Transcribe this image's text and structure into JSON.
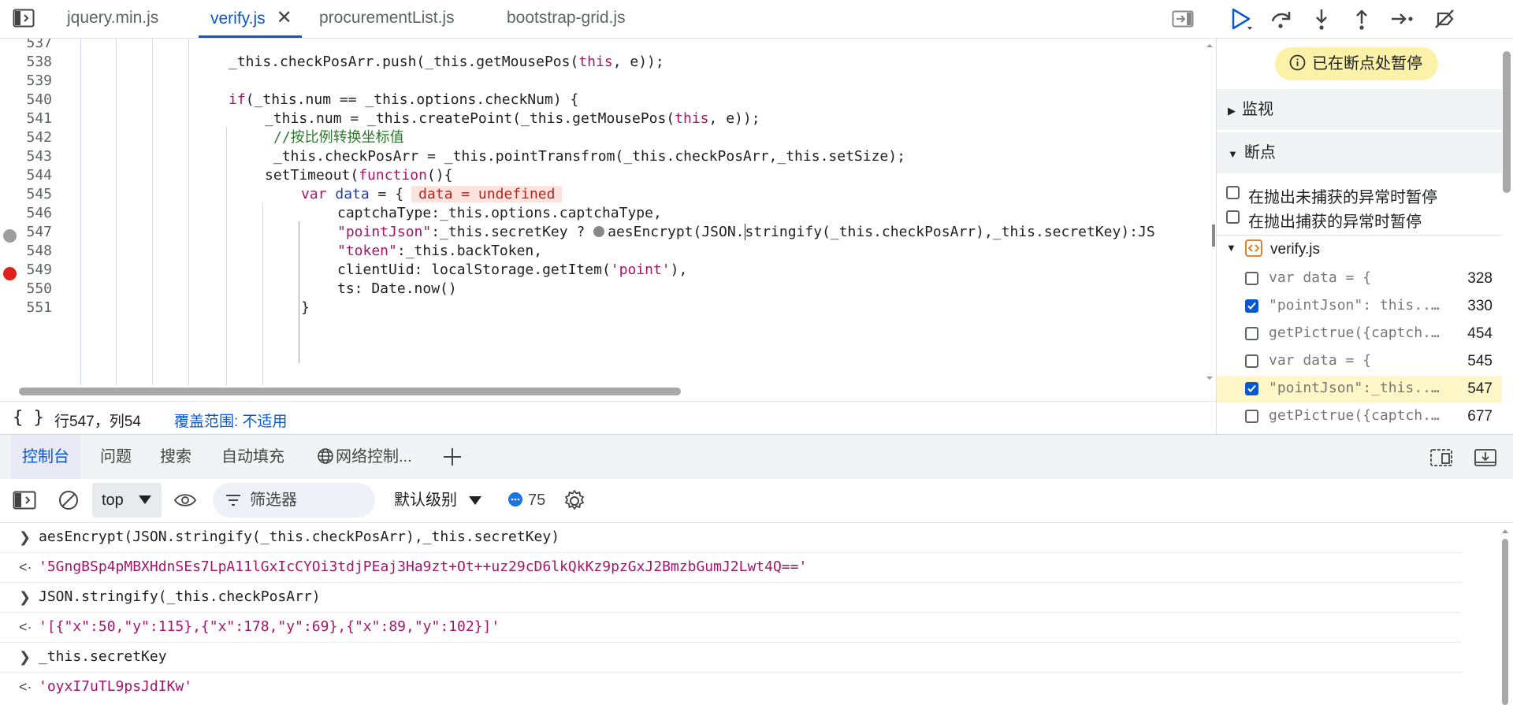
{
  "tabs": [
    {
      "label": "jquery.min.js",
      "active": false
    },
    {
      "label": "verify.js",
      "active": true
    },
    {
      "label": "procurementList.js",
      "active": false
    },
    {
      "label": "bootstrap-grid.js",
      "active": false
    }
  ],
  "code": {
    "lines": [
      {
        "n": "537"
      },
      {
        "n": "538"
      },
      {
        "n": "539"
      },
      {
        "n": "540"
      },
      {
        "n": "541"
      },
      {
        "n": "542"
      },
      {
        "n": "543"
      },
      {
        "n": "544"
      },
      {
        "n": "545"
      },
      {
        "n": "546"
      },
      {
        "n": "547"
      },
      {
        "n": "548"
      },
      {
        "n": "549"
      },
      {
        "n": "550"
      },
      {
        "n": "551"
      }
    ],
    "l538": "_this.checkPosArr.push(_this.getMousePos(",
    "l538_kw": "this",
    "l538_end": ", e));",
    "l540_kw": "if",
    "l540": "(_this.num == _this.options.checkNum) {",
    "l541": "_this.num = _this.createPoint(_this.getMousePos(",
    "l541_kw": "this",
    "l541_end": ", e));",
    "l542": "//按比例转换坐标值",
    "l543": "_this.checkPosArr = _this.pointTransfrom(_this.checkPosArr,_this.setSize);",
    "l544_a": "setTimeout(",
    "l544_kw": "function",
    "l544_b": "(){",
    "l545_kw": "var",
    "l545_var": "data",
    "l545_b": " = {",
    "l545_inline": "data = undefined",
    "l546": "captchaType:_this.options.captchaType,",
    "l547_str": "\"pointJson\"",
    "l547_a": ":_this.secretKey ? ",
    "l547_b": "aesEncrypt(JSON.",
    "l547_c": "stringify(_this.checkPosArr),_this.secretKey):JS",
    "l548_str": "\"token\"",
    "l548_a": ":_this.backToken,",
    "l549_a": "clientUid: localStorage.getItem(",
    "l549_str": "'point'",
    "l549_b": "),",
    "l550": "ts: Date.now()",
    "l551": "}"
  },
  "status": {
    "braces": "{ }",
    "position": "行547，列54",
    "coverage": "覆盖范围: 不适用"
  },
  "debugger": {
    "paused_label": "已在断点处暂停",
    "watch_label": "监视",
    "breakpoints_label": "断点",
    "pause_uncaught": "在抛出未捕获的异常时暂停",
    "pause_caught": "在抛出捕获的异常时暂停",
    "file": "verify.js",
    "breakpoints": [
      {
        "text": "var data = {",
        "line": "328",
        "checked": false,
        "highlight": false
      },
      {
        "text": "\"pointJson\": this....",
        "line": "330",
        "checked": true,
        "highlight": false
      },
      {
        "text": "getPictrue({captch...",
        "line": "454",
        "checked": false,
        "highlight": false
      },
      {
        "text": "var data = {",
        "line": "545",
        "checked": false,
        "highlight": false
      },
      {
        "text": "\"pointJson\":_this....",
        "line": "547",
        "checked": true,
        "highlight": true
      },
      {
        "text": "getPictrue({captch...",
        "line": "677",
        "checked": false,
        "highlight": false
      }
    ]
  },
  "drawer": {
    "tabs": [
      "控制台",
      "问题",
      "搜索",
      "自动填充",
      "网络控制..."
    ]
  },
  "console_toolbar": {
    "context": "top",
    "filter_placeholder": "筛选器",
    "level": "默认级别",
    "message_count": "75"
  },
  "console": {
    "lines": [
      {
        "type": "input",
        "text": "aesEncrypt(JSON.stringify(_this.checkPosArr),_this.secretKey)"
      },
      {
        "type": "result",
        "text": "'5GngBSp4pMBXHdnSEs7LpA11lGxIcCYOi3tdjPEaj3Ha9zt+Ot++uz29cD6lkQkKz9pzGxJ2BmzbGumJ2Lwt4Q=='"
      },
      {
        "type": "input",
        "text": "JSON.stringify(_this.checkPosArr)"
      },
      {
        "type": "result",
        "text": "'[{\"x\":50,\"y\":115},{\"x\":178,\"y\":69},{\"x\":89,\"y\":102}]'"
      },
      {
        "type": "input",
        "text": "_this.secretKey"
      },
      {
        "type": "result",
        "text": "'oyxI7uTL9psJdIKw'"
      }
    ]
  }
}
